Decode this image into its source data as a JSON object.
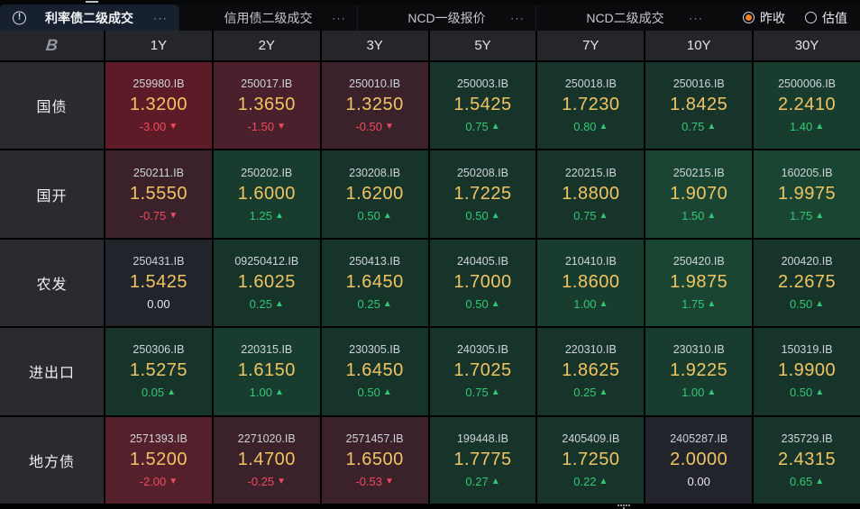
{
  "topbar": {
    "alert_icon": "!",
    "menu_icon": "···",
    "tabs": [
      {
        "label": "利率债二级成交",
        "active": true
      },
      {
        "label": "信用债二级成交",
        "active": false
      },
      {
        "label": "NCD一级报价",
        "active": false
      },
      {
        "label": "NCD二级成交",
        "active": false
      }
    ],
    "radios": [
      {
        "label": "昨收",
        "selected": true
      },
      {
        "label": "估值",
        "selected": false
      }
    ]
  },
  "table": {
    "logo_glyph": "B",
    "columns": [
      "1Y",
      "2Y",
      "3Y",
      "5Y",
      "7Y",
      "10Y",
      "30Y"
    ],
    "arrows": {
      "up": "▲",
      "down": "▼"
    },
    "rows": [
      {
        "label": "国债",
        "cells": [
          {
            "code": "259980.IB",
            "price": "1.3200",
            "change": -3.0
          },
          {
            "code": "250017.IB",
            "price": "1.3650",
            "change": -1.5
          },
          {
            "code": "250010.IB",
            "price": "1.3250",
            "change": -0.5
          },
          {
            "code": "250003.IB",
            "price": "1.5425",
            "change": 0.75
          },
          {
            "code": "250018.IB",
            "price": "1.7230",
            "change": 0.8
          },
          {
            "code": "250016.IB",
            "price": "1.8425",
            "change": 0.75
          },
          {
            "code": "2500006.IB",
            "price": "2.2410",
            "change": 1.4
          }
        ]
      },
      {
        "label": "国开",
        "cells": [
          {
            "code": "250211.IB",
            "price": "1.5550",
            "change": -0.75
          },
          {
            "code": "250202.IB",
            "price": "1.6000",
            "change": 1.25
          },
          {
            "code": "230208.IB",
            "price": "1.6200",
            "change": 0.5
          },
          {
            "code": "250208.IB",
            "price": "1.7225",
            "change": 0.5
          },
          {
            "code": "220215.IB",
            "price": "1.8800",
            "change": 0.75
          },
          {
            "code": "250215.IB",
            "price": "1.9070",
            "change": 1.5
          },
          {
            "code": "160205.IB",
            "price": "1.9975",
            "change": 1.75
          }
        ]
      },
      {
        "label": "农发",
        "cells": [
          {
            "code": "250431.IB",
            "price": "1.5425",
            "change": 0.0
          },
          {
            "code": "09250412.IB",
            "price": "1.6025",
            "change": 0.25
          },
          {
            "code": "250413.IB",
            "price": "1.6450",
            "change": 0.25
          },
          {
            "code": "240405.IB",
            "price": "1.7000",
            "change": 0.5
          },
          {
            "code": "210410.IB",
            "price": "1.8600",
            "change": 1.0
          },
          {
            "code": "250420.IB",
            "price": "1.9875",
            "change": 1.75
          },
          {
            "code": "200420.IB",
            "price": "2.2675",
            "change": 0.5
          }
        ]
      },
      {
        "label": "进出口",
        "cells": [
          {
            "code": "250306.IB",
            "price": "1.5275",
            "change": 0.05
          },
          {
            "code": "220315.IB",
            "price": "1.6150",
            "change": 1.0
          },
          {
            "code": "230305.IB",
            "price": "1.6450",
            "change": 0.5
          },
          {
            "code": "240305.IB",
            "price": "1.7025",
            "change": 0.75
          },
          {
            "code": "220310.IB",
            "price": "1.8625",
            "change": 0.25
          },
          {
            "code": "230310.IB",
            "price": "1.9225",
            "change": 1.0
          },
          {
            "code": "150319.IB",
            "price": "1.9900",
            "change": 0.5
          }
        ]
      },
      {
        "label": "地方债",
        "cells": [
          {
            "code": "2571393.IB",
            "price": "1.5200",
            "change": -2.0
          },
          {
            "code": "2271020.IB",
            "price": "1.4700",
            "change": -0.25
          },
          {
            "code": "2571457.IB",
            "price": "1.6500",
            "change": -0.53
          },
          {
            "code": "199448.IB",
            "price": "1.7775",
            "change": 0.27
          },
          {
            "code": "2405409.IB",
            "price": "1.7250",
            "change": 0.22
          },
          {
            "code": "2405287.IB",
            "price": "2.0000",
            "change": 0.0
          },
          {
            "code": "235729.IB",
            "price": "2.4315",
            "change": 0.65
          }
        ]
      }
    ]
  },
  "colors": {
    "accent_orange": "#f5821f",
    "up_text": "#33c676",
    "down_text": "#f04a5e",
    "zero_text": "#e6e8ec",
    "price_text": "#f1c463",
    "code_text": "#ced3da",
    "cell_neutral": "#21242b",
    "down_bg_tiers": [
      "#3b2129",
      "#49202b",
      "#53202c",
      "#5d1b27"
    ],
    "up_bg_tiers": [
      "#17342b",
      "#183d2f",
      "#1a4533"
    ]
  }
}
